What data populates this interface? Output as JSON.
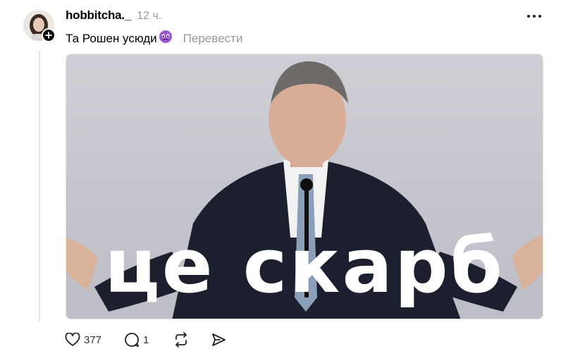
{
  "post": {
    "username": "hobbitcha._",
    "time": "12 ч.",
    "text": "Та Рошен усюди",
    "emoji_icon": "worried-face-purple",
    "translate_label": "Перевести",
    "media": {
      "overlay_text": "це скарб"
    },
    "actions": {
      "likes": "377",
      "replies": "1"
    }
  },
  "colors": {
    "muted": "#999999",
    "thread_line": "#e5e5e5",
    "media_bg": "#c9c9d1"
  }
}
